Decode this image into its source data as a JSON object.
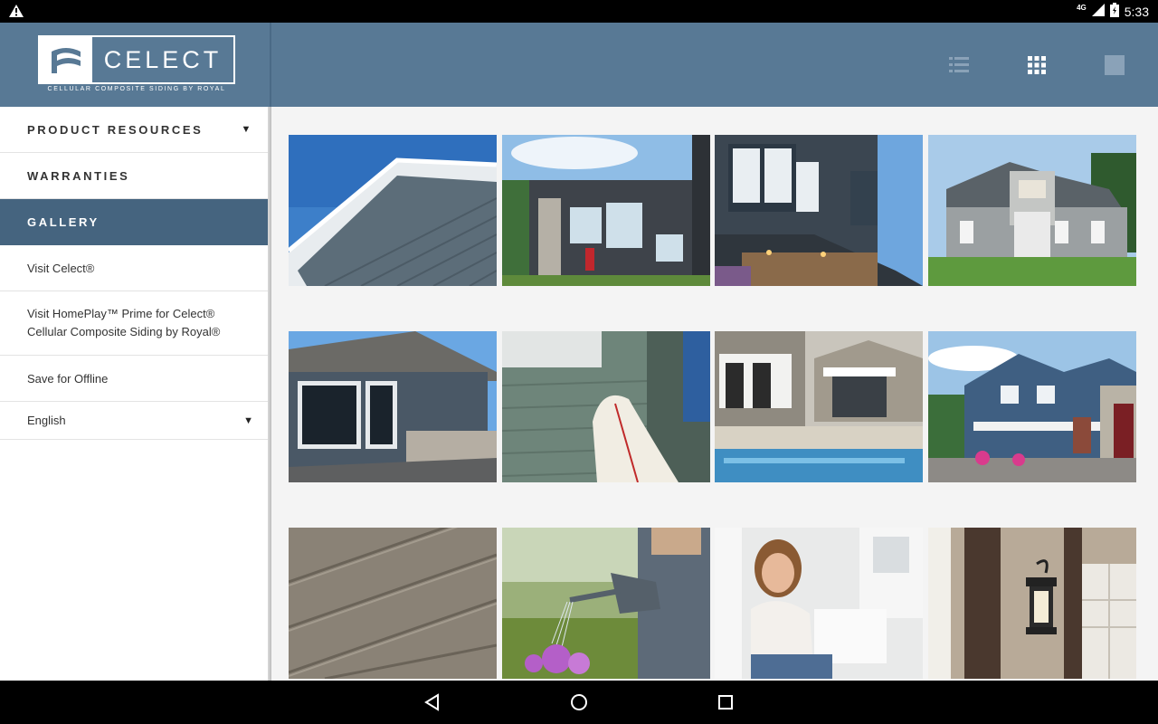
{
  "status_bar": {
    "time": "5:33",
    "network": "4G",
    "icons": [
      "warning-icon",
      "signal-icon",
      "battery-icon"
    ]
  },
  "brand": {
    "name": "CELECT",
    "registered": "®",
    "tagline": "CELLULAR COMPOSITE SIDING BY ROYAL"
  },
  "sidebar": {
    "items": [
      {
        "label": "PRODUCT RESOURCES",
        "caret": "▼"
      },
      {
        "label": "WARRANTIES"
      },
      {
        "label": "GALLERY",
        "active": true
      },
      {
        "label": "Visit Celect®"
      },
      {
        "label_line1": "Visit HomePlay™ Prime for Celect®",
        "label_line2": "Cellular Composite Siding by Royal®"
      },
      {
        "label": "Save for Offline"
      },
      {
        "label": "English",
        "caret": "▼"
      }
    ]
  },
  "toolbar": {
    "views": [
      "list-view-icon",
      "grid-view-icon",
      "single-view-icon"
    ],
    "active_view": "grid-view-icon"
  },
  "gallery": {
    "tiles": [
      "siding-eave-closeup",
      "modern-two-story-house",
      "dark-siding-house-dusk",
      "gray-craftsman-house",
      "dark-siding-window-detail",
      "green-siding-surfboard",
      "pool-patio-house",
      "blue-victorian-house",
      "brown-siding-texture",
      "gardener-watering-flowers",
      "smiling-woman-porch",
      "porch-lantern-detail"
    ]
  },
  "colors": {
    "header": "#587995",
    "active_item": "#45647f",
    "background": "#f4f4f4"
  }
}
